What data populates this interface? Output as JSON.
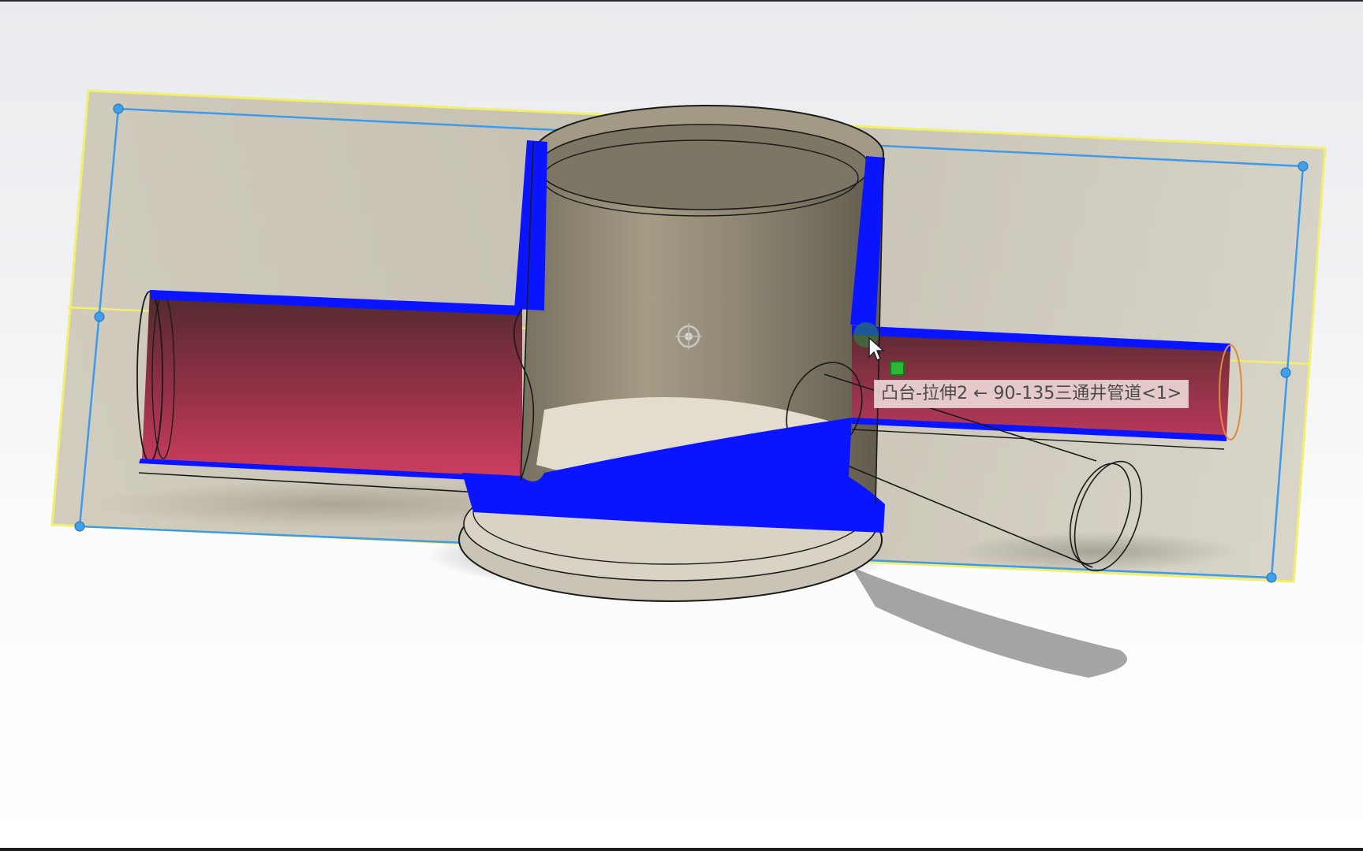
{
  "viewport": {
    "tooltip_text": "凸台-拉伸2 ← 90-135三通井管道<1>"
  },
  "colors": {
    "section_cut": "#0a14ff",
    "pipe_interior": "#b8385a",
    "plane_outline": "#f1ef6c",
    "plane_fill": "#bdb6a2",
    "sketch_line": "#3d9be9",
    "select_marker": "#2fb53a"
  },
  "icons": [
    "cursor-icon",
    "select-marker-icon",
    "plane-origin-icon"
  ]
}
